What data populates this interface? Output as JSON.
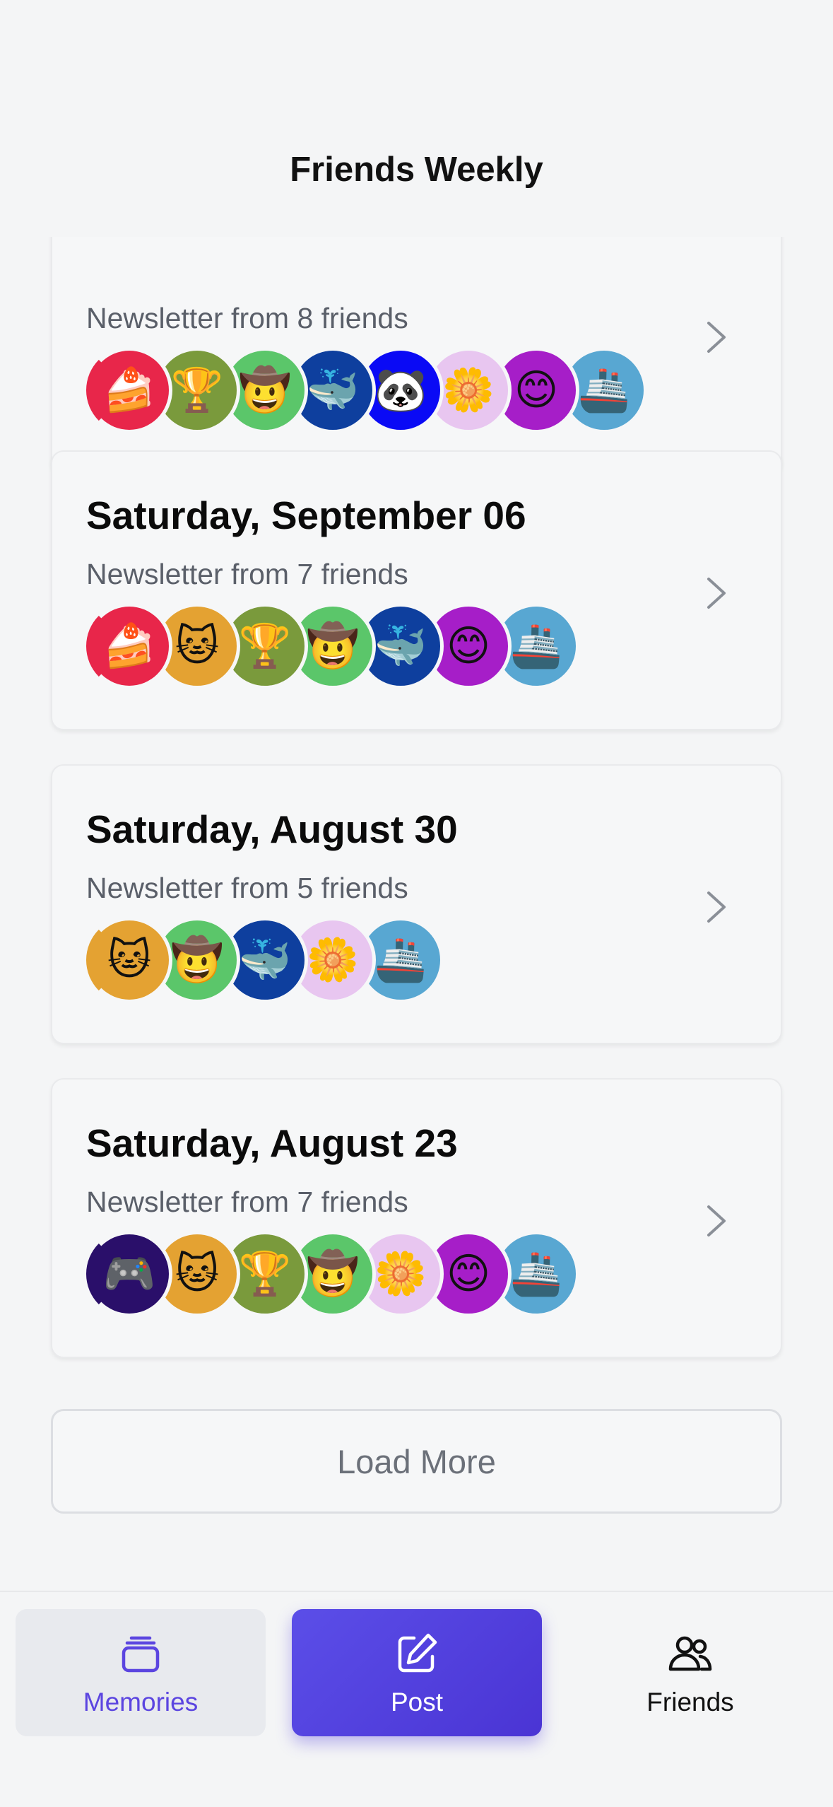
{
  "header": {
    "title": "Friends Weekly"
  },
  "colors": {
    "accent": "#5b45e0",
    "chevron": "#8a8f97"
  },
  "newsletters": [
    {
      "date": "",
      "subtitle": "Newsletter from 8 friends",
      "avatars": [
        {
          "emoji": "🍰",
          "bg": "#e8264a",
          "name": "cake-avatar"
        },
        {
          "emoji": "🏆",
          "bg": "#7a9a3c",
          "name": "trophy-avatar"
        },
        {
          "emoji": "🤠",
          "bg": "#5bc66a",
          "name": "cowboy-avatar"
        },
        {
          "emoji": "🐳",
          "bg": "#0e3f9e",
          "name": "whale-avatar"
        },
        {
          "emoji": "🐼",
          "bg": "#0a0af5",
          "name": "panda-avatar"
        },
        {
          "emoji": "🌼",
          "bg": "#e8c6f0",
          "name": "flower-avatar"
        },
        {
          "emoji": "😊",
          "bg": "#a61ec8",
          "name": "smile-avatar"
        },
        {
          "emoji": "🚢",
          "bg": "#58a7d2",
          "name": "ship-avatar"
        }
      ]
    },
    {
      "date": "Saturday, September 06",
      "subtitle": "Newsletter from 7 friends",
      "avatars": [
        {
          "emoji": "🍰",
          "bg": "#e8264a",
          "name": "cake-avatar"
        },
        {
          "emoji": "🐱",
          "bg": "#e4a232",
          "name": "cat-avatar"
        },
        {
          "emoji": "🏆",
          "bg": "#7a9a3c",
          "name": "trophy-avatar"
        },
        {
          "emoji": "🤠",
          "bg": "#5bc66a",
          "name": "cowboy-avatar"
        },
        {
          "emoji": "🐳",
          "bg": "#0e3f9e",
          "name": "whale-avatar"
        },
        {
          "emoji": "😊",
          "bg": "#a61ec8",
          "name": "smile-avatar"
        },
        {
          "emoji": "🚢",
          "bg": "#58a7d2",
          "name": "ship-avatar"
        }
      ]
    },
    {
      "date": "Saturday, August 30",
      "subtitle": "Newsletter from 5 friends",
      "avatars": [
        {
          "emoji": "🐱",
          "bg": "#e4a232",
          "name": "cat-avatar"
        },
        {
          "emoji": "🤠",
          "bg": "#5bc66a",
          "name": "cowboy-avatar"
        },
        {
          "emoji": "🐳",
          "bg": "#0e3f9e",
          "name": "whale-avatar"
        },
        {
          "emoji": "🌼",
          "bg": "#e8c6f0",
          "name": "flower-avatar"
        },
        {
          "emoji": "🚢",
          "bg": "#58a7d2",
          "name": "ship-avatar"
        }
      ]
    },
    {
      "date": "Saturday, August 23",
      "subtitle": "Newsletter from 7 friends",
      "avatars": [
        {
          "emoji": "🎮",
          "bg": "#2a0f6a",
          "name": "gamepad-avatar"
        },
        {
          "emoji": "🐱",
          "bg": "#e4a232",
          "name": "cat-avatar"
        },
        {
          "emoji": "🏆",
          "bg": "#7a9a3c",
          "name": "trophy-avatar"
        },
        {
          "emoji": "🤠",
          "bg": "#5bc66a",
          "name": "cowboy-avatar"
        },
        {
          "emoji": "🌼",
          "bg": "#e8c6f0",
          "name": "flower-avatar"
        },
        {
          "emoji": "😊",
          "bg": "#a61ec8",
          "name": "smile-avatar"
        },
        {
          "emoji": "🚢",
          "bg": "#58a7d2",
          "name": "ship-avatar"
        }
      ]
    }
  ],
  "load_more_label": "Load More",
  "tabbar": {
    "memories": {
      "label": "Memories",
      "icon": "stack-icon"
    },
    "post": {
      "label": "Post",
      "icon": "edit-icon"
    },
    "friends": {
      "label": "Friends",
      "icon": "people-icon"
    }
  }
}
